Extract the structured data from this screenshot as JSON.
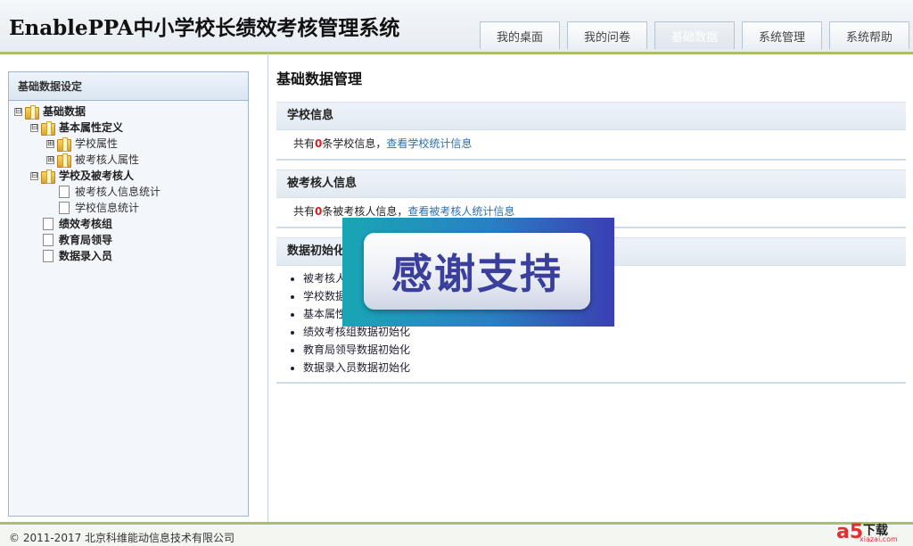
{
  "app": {
    "title": "EnablePPA中小学校长绩效考核管理系统"
  },
  "nav": {
    "tabs": [
      {
        "label": "我的桌面"
      },
      {
        "label": "我的问卷"
      },
      {
        "label": "基础数据",
        "active": true
      },
      {
        "label": "系统管理"
      },
      {
        "label": "系统帮助"
      }
    ]
  },
  "sidebar": {
    "title": "基础数据设定",
    "tree": {
      "root": "基础数据",
      "basic_attr": "基本属性定义",
      "school_attr": "学校属性",
      "examinee_attr": "被考核人属性",
      "school_examinee": "学校及被考核人",
      "examinee_stats": "被考核人信息统计",
      "school_stats": "学校信息统计",
      "perf_group": "绩效考核组",
      "edu_leader": "教育局领导",
      "data_entry": "数据录入员"
    },
    "toggle_minus": "⊟",
    "toggle_plus": "⊞"
  },
  "main": {
    "title": "基础数据管理",
    "school": {
      "header": "学校信息",
      "text_prefix": "共有",
      "count": "0",
      "text_suffix": "条学校信息，",
      "link": "查看学校统计信息"
    },
    "examinee": {
      "header": "被考核人信息",
      "text_prefix": "共有",
      "count": "0",
      "text_suffix": "条被考核人信息，",
      "link": "查看被考核人统计信息"
    },
    "init": {
      "header": "数据初始化",
      "items": [
        "被考核人数据初始化",
        "学校数据初始化",
        "基本属性数据初始化",
        "绩效考核组数据初始化",
        "教育局领导数据初始化",
        "数据录入员数据初始化"
      ]
    }
  },
  "overlay": {
    "text": "感谢支持"
  },
  "footer": {
    "copyright": "© 2011-2017 北京科维能动信息技术有限公司"
  },
  "watermark": {
    "brand": "a5",
    "label": "下载",
    "url": "xiazai.com"
  }
}
